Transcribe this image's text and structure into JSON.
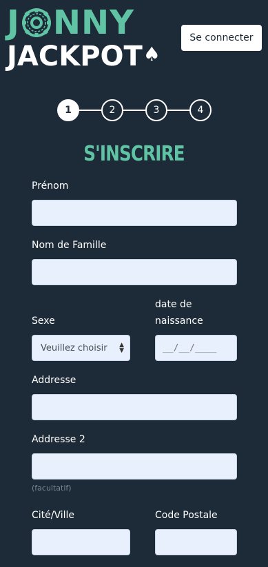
{
  "header": {
    "logo_top": [
      "J",
      "NNY"
    ],
    "logo_bottom": "JACKPOT",
    "login_label": "Se connecter"
  },
  "steps": [
    "1",
    "2",
    "3",
    "4"
  ],
  "active_step": 1,
  "form": {
    "title": "S'INSCRIRE",
    "first_name_label": "Prénom",
    "first_name_value": "",
    "last_name_label": "Nom de Famille",
    "last_name_value": "",
    "sex_label": "Sexe",
    "sex_selected": "Veuillez choisir",
    "birthdate_label_line1": "date de",
    "birthdate_label_line2": "naissance",
    "birthdate_placeholder": "__/__/____",
    "address_label": "Addresse",
    "address_value": "",
    "address2_label": "Addresse 2",
    "address2_value": "",
    "address2_hint": "(facultatif)",
    "city_label": "Cité/Ville",
    "city_value": "",
    "postal_label": "Code Postale",
    "postal_value": ""
  },
  "colors": {
    "background": "#1d2a37",
    "accent": "#5fc3a4",
    "input_bg": "#e8f0fe"
  }
}
